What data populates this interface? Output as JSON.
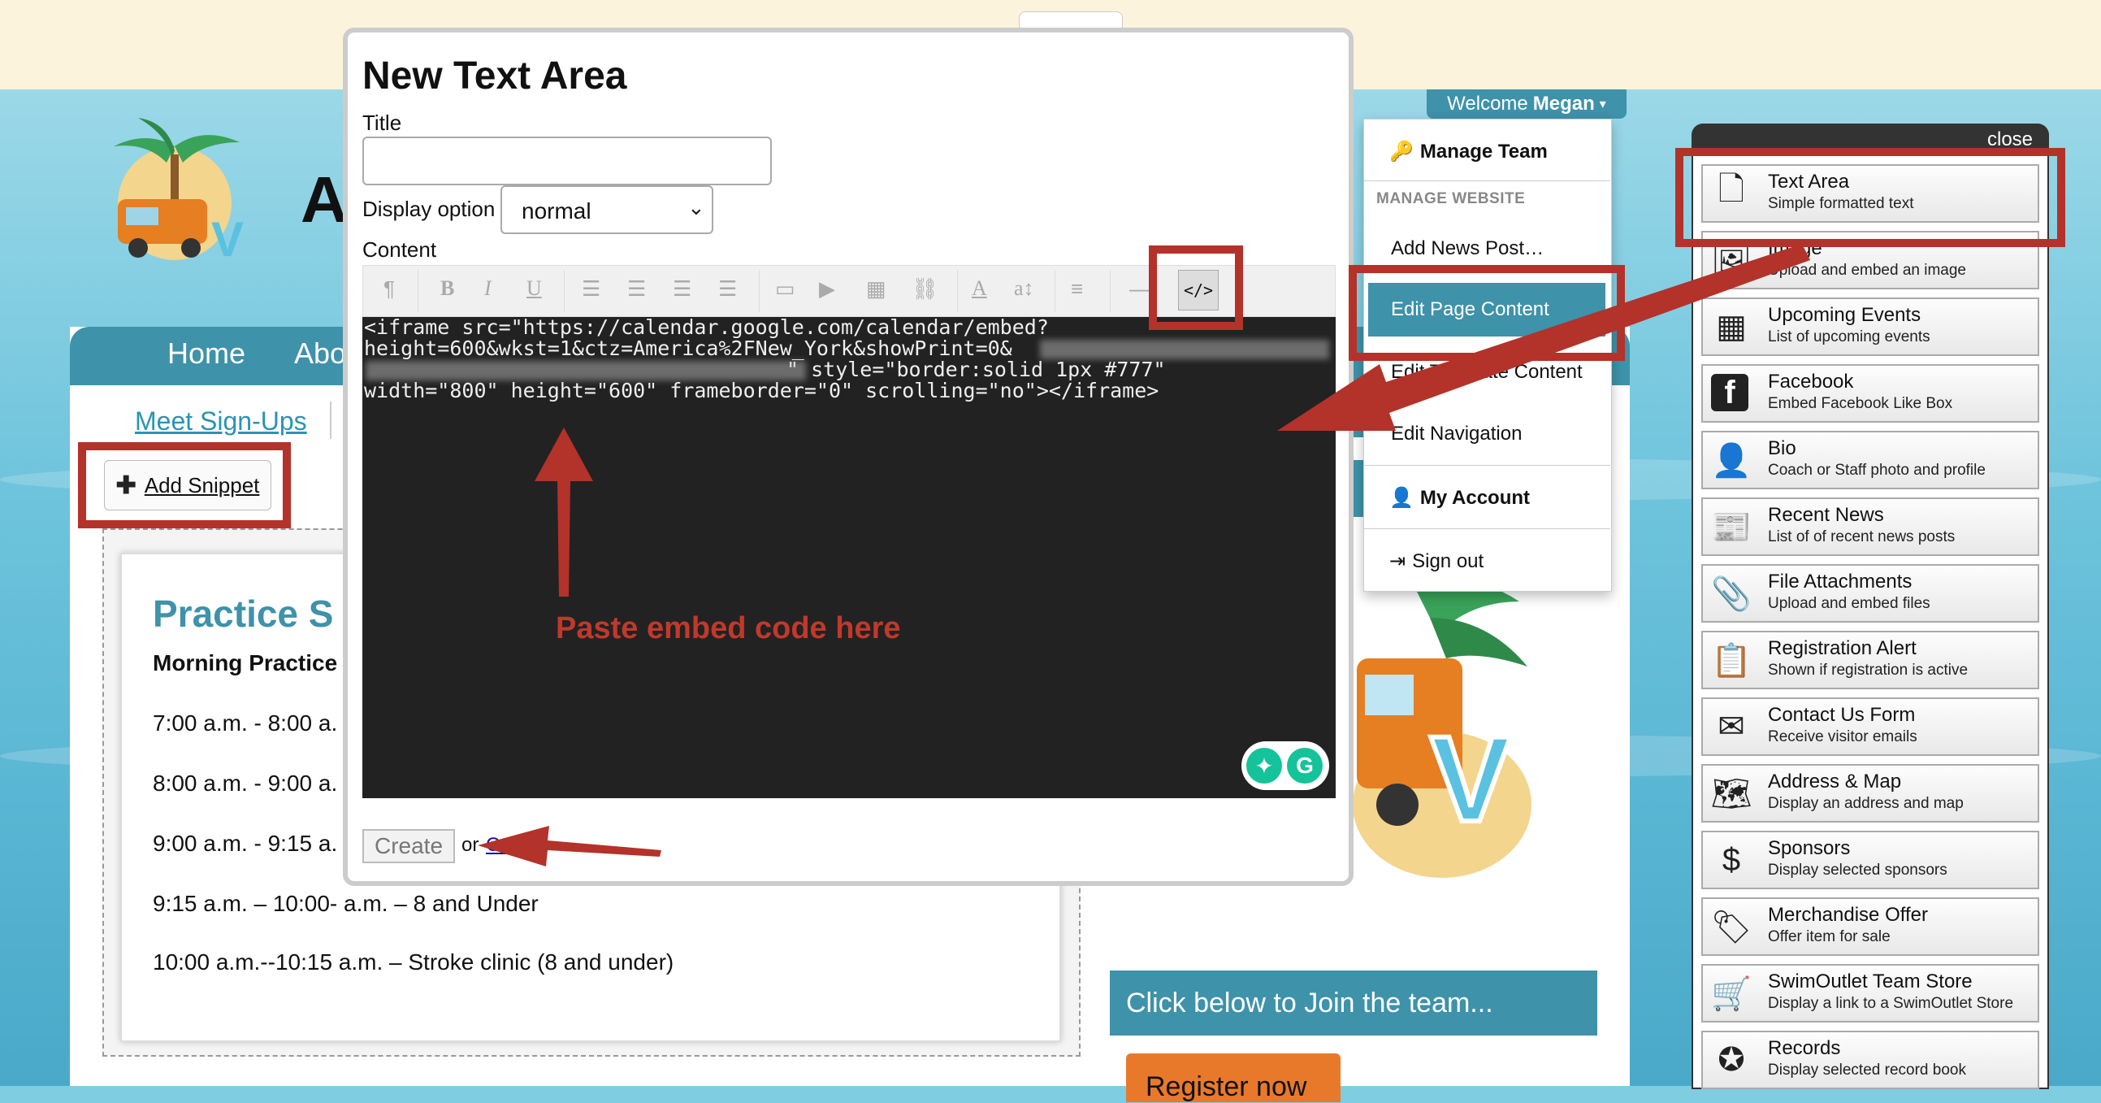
{
  "site": {
    "title_initial": "A",
    "nav": [
      "Home",
      "Abo"
    ],
    "subnav_link": "Meet Sign-Ups",
    "add_snippet": "Add Snippet",
    "practice": {
      "title": "Practice S",
      "subtitle": "Morning Practice",
      "lines": [
        "7:00 a.m. - 8:00 a.",
        "8:00 a.m. - 9:00 a.",
        "9:00 a.m. - 9:15 a.",
        "9:15 a.m. – 10:00- a.m. – 8 and Under",
        "10:00 a.m.--10:15 a.m. – Stroke clinic (8 and under)"
      ]
    },
    "join_bar": "Click below to Join the team...",
    "register_button": "Register now"
  },
  "user_menu": {
    "welcome": "Welcome",
    "user_name": "Megan",
    "manage_team": "Manage Team",
    "manage_website_header": "MANAGE WEBSITE",
    "add_news": "Add News Post…",
    "edit_page_content": "Edit Page Content",
    "edit_template_content": "Edit Template Content",
    "edit_navigation": "Edit Navigation",
    "my_account": "My Account",
    "sign_out": "Sign out"
  },
  "snippets_panel": {
    "close_label": "close",
    "items": [
      {
        "title": "Text Area",
        "desc": "Simple formatted text",
        "icon": "file-icon"
      },
      {
        "title": "Image",
        "desc": "Upload and embed an image",
        "icon": "image-icon"
      },
      {
        "title": "Upcoming Events",
        "desc": "List of upcoming events",
        "icon": "calendar-icon"
      },
      {
        "title": "Facebook",
        "desc": "Embed Facebook Like Box",
        "icon": "facebook-icon"
      },
      {
        "title": "Bio",
        "desc": "Coach or Staff photo and profile",
        "icon": "bio-icon"
      },
      {
        "title": "Recent News",
        "desc": "List of of recent news posts",
        "icon": "newspaper-icon"
      },
      {
        "title": "File Attachments",
        "desc": "Upload and embed files",
        "icon": "paperclip-icon"
      },
      {
        "title": "Registration Alert",
        "desc": "Shown if registration is active",
        "icon": "clipboard-check-icon"
      },
      {
        "title": "Contact Us Form",
        "desc": "Receive visitor emails",
        "icon": "envelope-icon"
      },
      {
        "title": "Address & Map",
        "desc": "Display an address and map",
        "icon": "map-icon"
      },
      {
        "title": "Sponsors",
        "desc": "Display selected sponsors",
        "icon": "coins-icon"
      },
      {
        "title": "Merchandise Offer",
        "desc": "Offer item for sale",
        "icon": "price-tag-icon"
      },
      {
        "title": "SwimOutlet Team Store",
        "desc": "Display a link to a SwimOutlet Store",
        "icon": "cart-icon"
      },
      {
        "title": "Records",
        "desc": "Display selected record book",
        "icon": "award-icon"
      }
    ]
  },
  "modal": {
    "title": "New Text Area",
    "title_label": "Title",
    "title_value": "",
    "display_option_label": "Display option",
    "display_option_value": "normal",
    "content_label": "Content",
    "code_button": "</>",
    "code_lines": [
      "<iframe src=\"https://calendar.google.com/calendar/embed?",
      "height=600&wkst=1&ctz=America%2FNew_York&showPrint=0&",
      "\" style=\"border:solid 1px #777\"",
      "width=\"800\" height=\"600\" frameborder=\"0\" scrolling=\"no\"></iframe>"
    ],
    "create_button": "Create",
    "or_text": "or",
    "cancel_link": "Cancel"
  },
  "annotation": {
    "paste_note": "Paste embed code here",
    "color": "#b3322a"
  }
}
